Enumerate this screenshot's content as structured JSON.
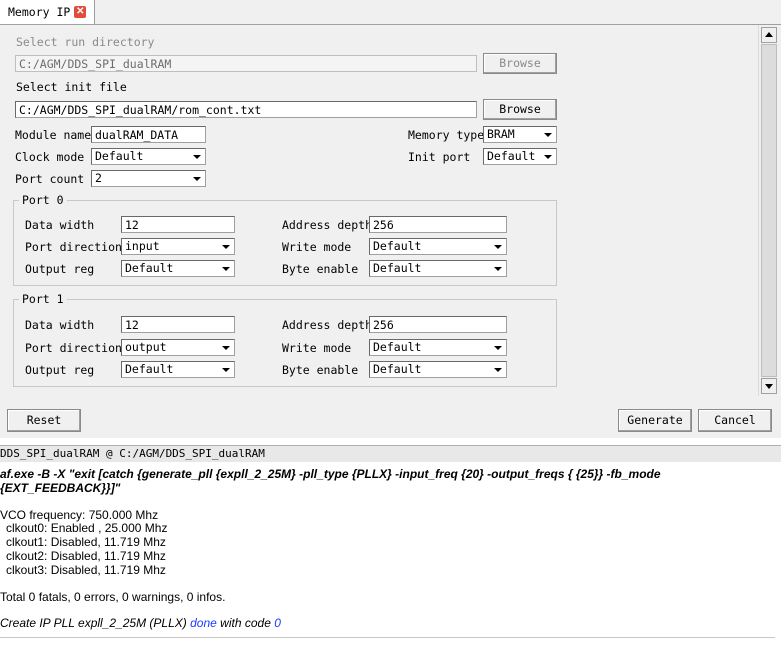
{
  "tab": {
    "title": "Memory IP",
    "close_icon": "close-icon"
  },
  "form": {
    "run_dir_label": "Select run directory",
    "run_dir_value": "C:/AGM/DDS_SPI_dualRAM",
    "browse_label": "Browse",
    "init_file_label": "Select init file",
    "init_file_value": "C:/AGM/DDS_SPI_dualRAM/rom_cont.txt",
    "module_name_label": "Module name",
    "module_name_value": "dualRAM_DATA",
    "memory_type_label": "Memory type",
    "memory_type_value": "BRAM",
    "clock_mode_label": "Clock mode",
    "clock_mode_value": "Default",
    "init_port_label": "Init port",
    "init_port_value": "Default",
    "port_count_label": "Port count",
    "port_count_value": "2"
  },
  "ports": [
    {
      "title": "Port 0",
      "data_width_label": "Data width",
      "data_width_value": "12",
      "address_depth_label": "Address depth",
      "address_depth_value": "256",
      "port_direction_label": "Port direction",
      "port_direction_value": "input",
      "write_mode_label": "Write mode",
      "write_mode_value": "Default",
      "output_reg_label": "Output reg",
      "output_reg_value": "Default",
      "byte_enable_label": "Byte enable",
      "byte_enable_value": "Default"
    },
    {
      "title": "Port 1",
      "data_width_label": "Data width",
      "data_width_value": "12",
      "address_depth_label": "Address depth",
      "address_depth_value": "256",
      "port_direction_label": "Port direction",
      "port_direction_value": "output",
      "write_mode_label": "Write mode",
      "write_mode_value": "Default",
      "output_reg_label": "Output reg",
      "output_reg_value": "Default",
      "byte_enable_label": "Byte enable",
      "byte_enable_value": "Default"
    }
  ],
  "buttons": {
    "reset": "Reset",
    "generate": "Generate",
    "cancel": "Cancel"
  },
  "console": {
    "title": "DDS_SPI_dualRAM @ C:/AGM/DDS_SPI_dualRAM",
    "command_line1": "af.exe -B -X \"exit [catch {generate_pll {expll_2_25M} -pll_type {PLLX} -input_freq {20} -output_freqs { {25}} -fb_mode",
    "command_line2": "{EXT_FEEDBACK}}]\"",
    "vco": "VCO frequency: 750.000 Mhz",
    "clk0": "clkout0: Enabled , 25.000 Mhz",
    "clk1": "clkout1: Disabled, 11.719 Mhz",
    "clk2": "clkout2: Disabled, 11.719 Mhz",
    "clk3": "clkout3: Disabled, 11.719 Mhz",
    "summary": "Total 0 fatals, 0 errors, 0 warnings, 0 infos.",
    "create_prefix": "Create IP PLL expll_2_25M (PLLX)",
    "create_done": "done",
    "create_mid": "with code",
    "create_code": "0"
  },
  "colors": {
    "panel_bg": "#f0f0f0",
    "link_blue": "#1a3cff",
    "close_red": "#e24b3b"
  }
}
